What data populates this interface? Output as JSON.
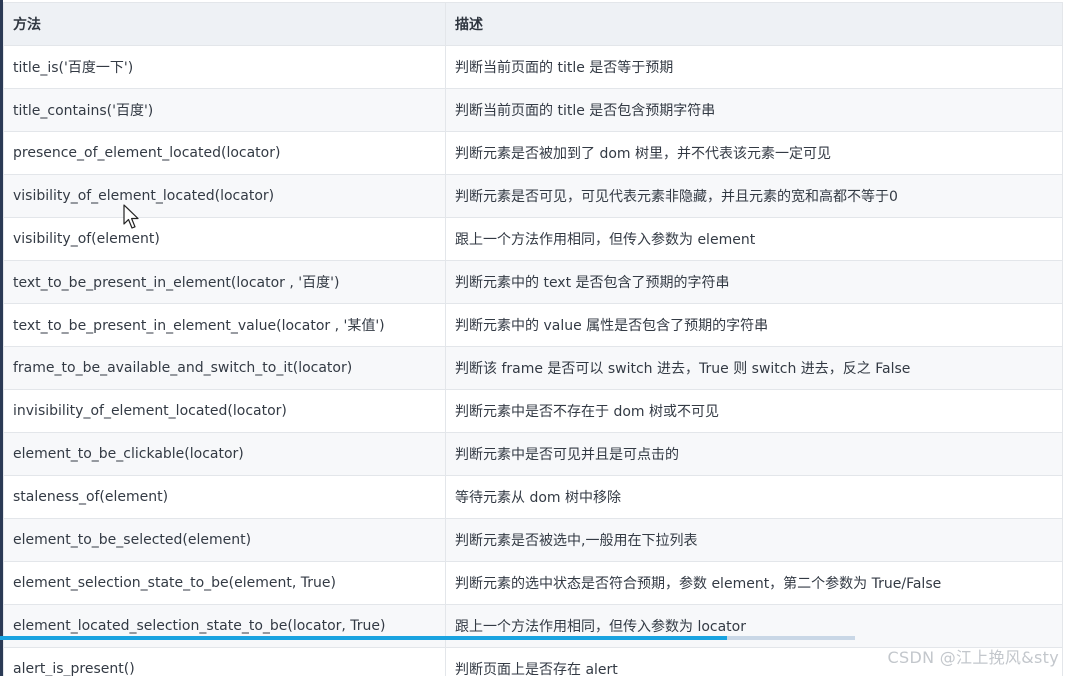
{
  "table": {
    "headers": {
      "method": "方法",
      "description": "描述"
    },
    "rows": [
      {
        "method": "title_is('百度一下')",
        "description": "判断当前页面的 title 是否等于预期"
      },
      {
        "method": "title_contains('百度')",
        "description": "判断当前页面的 title 是否包含预期字符串"
      },
      {
        "method": "presence_of_element_located(locator)",
        "description": "判断元素是否被加到了 dom 树里，并不代表该元素一定可见"
      },
      {
        "method": "visibility_of_element_located(locator)",
        "description": "判断元素是否可见，可见代表元素非隐藏，并且元素的宽和高都不等于0"
      },
      {
        "method": "visibility_of(element)",
        "description": "跟上一个方法作用相同，但传入参数为 element"
      },
      {
        "method": "text_to_be_present_in_element(locator , '百度')",
        "description": "判断元素中的 text 是否包含了预期的字符串"
      },
      {
        "method": "text_to_be_present_in_element_value(locator , '某值')",
        "description": "判断元素中的 value 属性是否包含了预期的字符串"
      },
      {
        "method": "frame_to_be_available_and_switch_to_it(locator)",
        "description": "判断该 frame 是否可以 switch 进去，True 则 switch 进去，反之 False"
      },
      {
        "method": "invisibility_of_element_located(locator)",
        "description": "判断元素中是否不存在于 dom 树或不可见"
      },
      {
        "method": "element_to_be_clickable(locator)",
        "description": "判断元素中是否可见并且是可点击的"
      },
      {
        "method": "staleness_of(element)",
        "description": "等待元素从 dom 树中移除"
      },
      {
        "method": "element_to_be_selected(element)",
        "description": "判断元素是否被选中,一般用在下拉列表"
      },
      {
        "method": "element_selection_state_to_be(element, True)",
        "description": "判断元素的选中状态是否符合预期，参数 element，第二个参数为 True/False"
      },
      {
        "method": "element_located_selection_state_to_be(locator, True)",
        "description": "跟上一个方法作用相同，但传入参数为 locator"
      },
      {
        "method": "alert_is_present()",
        "description": "判断页面上是否存在 alert"
      }
    ]
  },
  "video": {
    "progress_fraction": 0.85,
    "progress_color": "#1aa3e0"
  },
  "watermark": "CSDN @江上挽风&sty"
}
